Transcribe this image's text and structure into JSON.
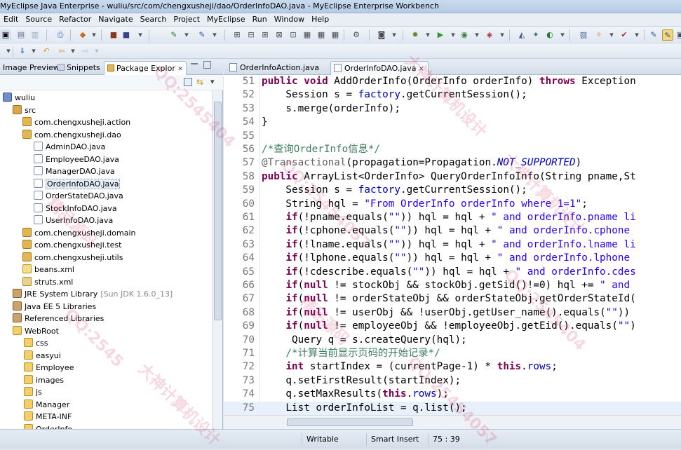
{
  "window": {
    "title": "MyEclipse Java Enterprise - wuliu/src/com/chengxusheji/dao/OrderInfoDAO.java - MyEclipse Enterprise Workbench"
  },
  "menu": [
    "Edit",
    "Source",
    "Refactor",
    "Navigate",
    "Search",
    "Project",
    "MyEclipse",
    "Run",
    "Window",
    "Help"
  ],
  "left_tabs": {
    "image_preview": "Image Preview",
    "snippets": "Snippets",
    "package_explorer": "Package Explor",
    "close": "✕"
  },
  "tree": [
    {
      "label": "wuliu",
      "icon": "project-icon"
    },
    {
      "label": "src",
      "icon": "source-folder-icon"
    },
    {
      "label": "com.chengxusheji.action",
      "icon": "package-icon"
    },
    {
      "label": "com.chengxusheji.dao",
      "icon": "package-icon"
    },
    {
      "label": "AdminDAO.java",
      "icon": "java-file-icon"
    },
    {
      "label": "EmployeeDAO.java",
      "icon": "java-file-icon"
    },
    {
      "label": "ManagerDAO.java",
      "icon": "java-file-icon"
    },
    {
      "label": "OrderInfoDAO.java",
      "icon": "java-file-icon",
      "selected": true
    },
    {
      "label": "OrderStateDAO.java",
      "icon": "java-file-icon"
    },
    {
      "label": "StockInfoDAO.java",
      "icon": "java-file-icon"
    },
    {
      "label": "UserInfoDAO.java",
      "icon": "java-file-icon"
    },
    {
      "label": "com.chengxusheji.domain",
      "icon": "package-icon"
    },
    {
      "label": "com.chengxusheji.test",
      "icon": "package-icon"
    },
    {
      "label": "com.chengxusheji.utils",
      "icon": "package-icon"
    },
    {
      "label": "beans.xml",
      "icon": "xml-file-icon"
    },
    {
      "label": "struts.xml",
      "icon": "xml-config-icon"
    },
    {
      "label": "JRE System Library",
      "extra": "[Sun JDK 1.6.0_13]",
      "icon": "library-icon"
    },
    {
      "label": "Java EE 5 Libraries",
      "icon": "library-icon"
    },
    {
      "label": "Referenced Libraries",
      "icon": "library-icon"
    },
    {
      "label": "WebRoot",
      "icon": "folder-icon"
    },
    {
      "label": "css",
      "icon": "folder-icon"
    },
    {
      "label": "easyui",
      "icon": "folder-icon"
    },
    {
      "label": "Employee",
      "icon": "folder-icon"
    },
    {
      "label": "images",
      "icon": "folder-icon"
    },
    {
      "label": "js",
      "icon": "folder-icon"
    },
    {
      "label": "Manager",
      "icon": "folder-icon"
    },
    {
      "label": "META-INF",
      "icon": "folder-icon"
    },
    {
      "label": "OrderInfo",
      "icon": "folder-icon"
    }
  ],
  "editor_tabs": {
    "tab1": "OrderInfoAction.java",
    "tab2": "OrderInfoDAO.java",
    "close": "✕"
  },
  "code": [
    {
      "n": "51",
      "t": "public void AddOrderInfo(OrderInfo orderInfo) throws Exception"
    },
    {
      "n": "52",
      "t": "    Session s = factory.getCurrentSession();"
    },
    {
      "n": "53",
      "t": "    s.merge(orderInfo);"
    },
    {
      "n": "54",
      "t": "}"
    },
    {
      "n": "55",
      "t": ""
    },
    {
      "n": "56",
      "t": "/*查询OrderInfo信息*/"
    },
    {
      "n": "57",
      "t": "@Transactional(propagation=Propagation.NOT_SUPPORTED)"
    },
    {
      "n": "58",
      "t": "public ArrayList<OrderInfo> QueryOrderInfoInfo(String pname,St"
    },
    {
      "n": "59",
      "t": "    Session s = factory.getCurrentSession();"
    },
    {
      "n": "60",
      "t": "    String hql = \"From OrderInfo orderInfo where 1=1\";"
    },
    {
      "n": "61",
      "t": "    if(!pname.equals(\"\")) hql = hql + \" and orderInfo.pname li"
    },
    {
      "n": "62",
      "t": "    if(!cphone.equals(\"\")) hql = hql + \" and orderInfo.cphone"
    },
    {
      "n": "63",
      "t": "    if(!lname.equals(\"\")) hql = hql + \" and orderInfo.lname li"
    },
    {
      "n": "64",
      "t": "    if(!lphone.equals(\"\")) hql = hql + \" and orderInfo.lphone"
    },
    {
      "n": "65",
      "t": "    if(!cdescribe.equals(\"\")) hql = hql + \" and orderInfo.cdes"
    },
    {
      "n": "66",
      "t": "    if(null != stockObj && stockObj.getSid()!=0) hql += \" and"
    },
    {
      "n": "67",
      "t": "    if(null != orderStateObj && orderStateObj.getOrderStateId("
    },
    {
      "n": "68",
      "t": "    if(null != userObj && !userObj.getUser_name().equals(\"\"))"
    },
    {
      "n": "69",
      "t": "    if(null != employeeObj && !employeeObj.getEid().equals(\"\")"
    },
    {
      "n": "70",
      "t": "     Query q = s.createQuery(hql);"
    },
    {
      "n": "71",
      "t": "    /*计算当前显示页码的开始记录*/"
    },
    {
      "n": "72",
      "t": "    int startIndex = (currentPage-1) * this.rows;"
    },
    {
      "n": "73",
      "t": "    q.setFirstResult(startIndex);"
    },
    {
      "n": "74",
      "t": "    q.setMaxResults(this.rows);"
    },
    {
      "n": "75",
      "t": "    List orderInfoList = q.list();"
    }
  ],
  "status": {
    "writable": "Writable",
    "insert_mode": "Smart Insert",
    "position": "75 : 39"
  },
  "watermarks": [
    "QQ:2545404",
    "大神计算机设计",
    "精品源码",
    "QQ:25454057",
    "大神计算机设计",
    "QQ:2545",
    "精品源码",
    "QQ:2545404",
    "大神计算机设计",
    "QQ:25454057"
  ]
}
